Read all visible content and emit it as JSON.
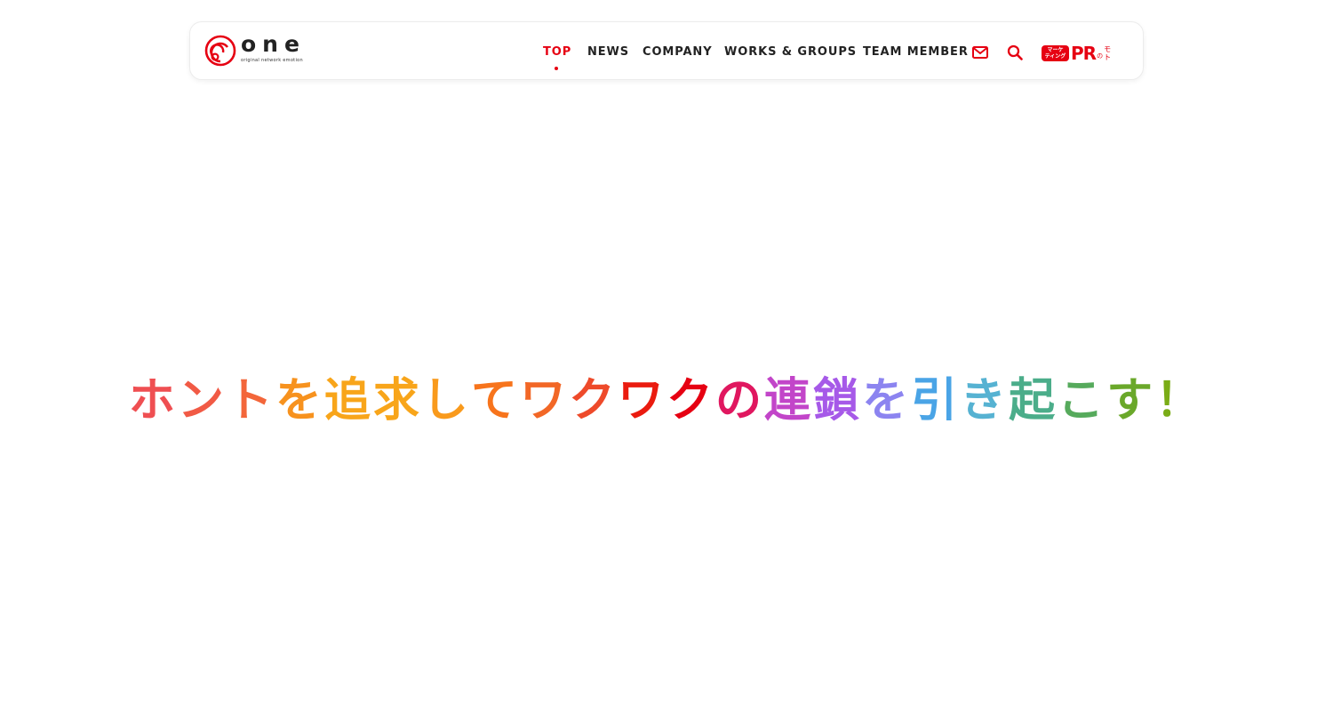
{
  "header": {
    "logo": {
      "word": "one",
      "tagline": "original network emotion"
    },
    "nav": {
      "items": [
        {
          "label": "TOP",
          "active": true
        },
        {
          "label": "NEWS",
          "active": false
        },
        {
          "label": "COMPANY",
          "active": false
        },
        {
          "label": "WORKS & GROUPS",
          "active": false
        },
        {
          "label": "TEAM MEMBER",
          "active": false
        }
      ]
    },
    "icons": {
      "mail": "mail-icon",
      "search": "search-icon"
    },
    "pr_logo": {
      "badge_line1": "マーケ",
      "badge_line2": "ティング",
      "main": "PR",
      "no": "の",
      "moto_1": "モ",
      "moto_2": "ト"
    }
  },
  "hero": {
    "text": "ホントを追求してワクワクの連鎖を引き起こす！",
    "chars": [
      {
        "c": "ホ",
        "color": "#ef4f52"
      },
      {
        "c": "ン",
        "color": "#f15a45"
      },
      {
        "c": "ト",
        "color": "#f3663a"
      },
      {
        "c": "を",
        "color": "#f7921e"
      },
      {
        "c": "追",
        "color": "#f8a51a"
      },
      {
        "c": "求",
        "color": "#f8a51a"
      },
      {
        "c": "し",
        "color": "#f99a1c"
      },
      {
        "c": "て",
        "color": "#f7741c"
      },
      {
        "c": "ワ",
        "color": "#f26726"
      },
      {
        "c": "ク",
        "color": "#ee4a2a"
      },
      {
        "c": "ワ",
        "color": "#ea1b0f"
      },
      {
        "c": "ク",
        "color": "#e60012"
      },
      {
        "c": "の",
        "color": "#e0175f"
      },
      {
        "c": "連",
        "color": "#c245c9"
      },
      {
        "c": "鎖",
        "color": "#a659e8"
      },
      {
        "c": "を",
        "color": "#8c84f0"
      },
      {
        "c": "引",
        "color": "#4aa4e6"
      },
      {
        "c": "き",
        "color": "#56b2d2"
      },
      {
        "c": "起",
        "color": "#4bad8a"
      },
      {
        "c": "こ",
        "color": "#56aa5c"
      },
      {
        "c": "す",
        "color": "#6aa82a"
      },
      {
        "c": "！",
        "color": "#7aac16"
      }
    ]
  },
  "colors": {
    "accent": "#e60012",
    "nav_text": "#222222"
  }
}
